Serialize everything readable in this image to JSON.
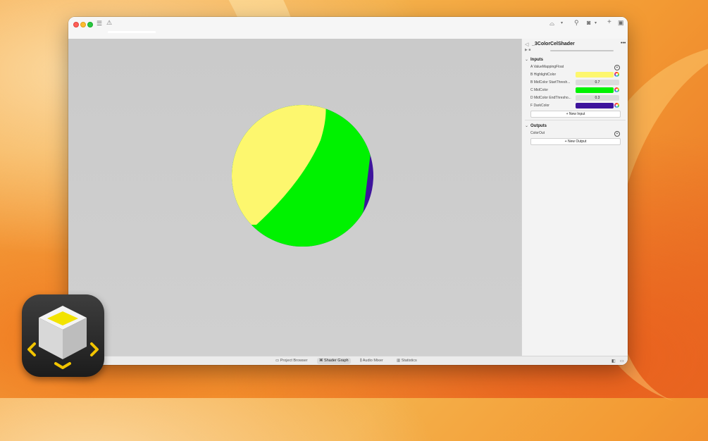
{
  "window": {
    "tab_title": ""
  },
  "inspector": {
    "title": "_3ColorCelShader",
    "more_icon": "ellipsis-icon",
    "inputs_header": "Inputs",
    "outputs_header": "Outputs",
    "inputs": [
      {
        "label": "A ValueMappingFloat",
        "kind": "link"
      },
      {
        "label": "B HighlightColor",
        "kind": "color",
        "color": "#fdf76e"
      },
      {
        "label": "B MidColor StartThresh...",
        "kind": "number",
        "value": "0.7"
      },
      {
        "label": "C MidColor",
        "kind": "color",
        "color": "#00f200"
      },
      {
        "label": "D MidColor EndThresho...",
        "kind": "number",
        "value": "0.3"
      },
      {
        "label": "F DarkColor",
        "kind": "color",
        "color": "#3e149c"
      }
    ],
    "new_input_label": "New Input",
    "outputs": [
      {
        "label": "ColorOut"
      }
    ],
    "new_output_label": "New Output"
  },
  "bottom_bar": {
    "tabs": [
      {
        "label": "Project Browser",
        "icon": "folder-icon",
        "active": false
      },
      {
        "label": "Shader Graph",
        "icon": "graph-icon",
        "active": true
      },
      {
        "label": "Audio Mixer",
        "icon": "audio-icon",
        "active": false
      },
      {
        "label": "Statistics",
        "icon": "chart-icon",
        "active": false
      }
    ]
  },
  "viewport": {
    "sphere_colors": {
      "highlight": "#fdf76e",
      "mid": "#00f200",
      "dark": "#3e149c"
    }
  }
}
